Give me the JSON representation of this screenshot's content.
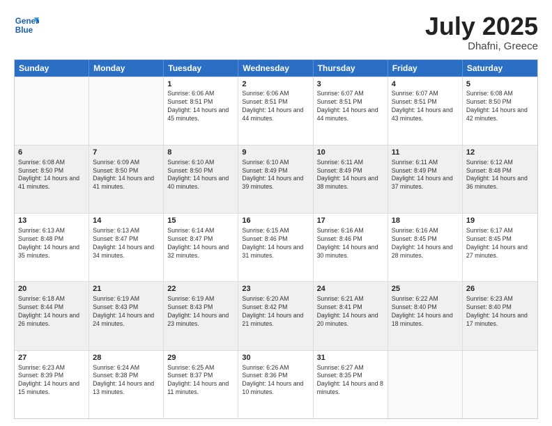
{
  "header": {
    "logo_line1": "General",
    "logo_line2": "Blue",
    "month": "July 2025",
    "location": "Dhafni, Greece"
  },
  "days_of_week": [
    "Sunday",
    "Monday",
    "Tuesday",
    "Wednesday",
    "Thursday",
    "Friday",
    "Saturday"
  ],
  "rows": [
    [
      {
        "day": "",
        "info": "",
        "empty": true
      },
      {
        "day": "",
        "info": "",
        "empty": true
      },
      {
        "day": "1",
        "info": "Sunrise: 6:06 AM\nSunset: 8:51 PM\nDaylight: 14 hours and 45 minutes."
      },
      {
        "day": "2",
        "info": "Sunrise: 6:06 AM\nSunset: 8:51 PM\nDaylight: 14 hours and 44 minutes."
      },
      {
        "day": "3",
        "info": "Sunrise: 6:07 AM\nSunset: 8:51 PM\nDaylight: 14 hours and 44 minutes."
      },
      {
        "day": "4",
        "info": "Sunrise: 6:07 AM\nSunset: 8:51 PM\nDaylight: 14 hours and 43 minutes."
      },
      {
        "day": "5",
        "info": "Sunrise: 6:08 AM\nSunset: 8:50 PM\nDaylight: 14 hours and 42 minutes."
      }
    ],
    [
      {
        "day": "6",
        "info": "Sunrise: 6:08 AM\nSunset: 8:50 PM\nDaylight: 14 hours and 41 minutes.",
        "shaded": true
      },
      {
        "day": "7",
        "info": "Sunrise: 6:09 AM\nSunset: 8:50 PM\nDaylight: 14 hours and 41 minutes.",
        "shaded": true
      },
      {
        "day": "8",
        "info": "Sunrise: 6:10 AM\nSunset: 8:50 PM\nDaylight: 14 hours and 40 minutes.",
        "shaded": true
      },
      {
        "day": "9",
        "info": "Sunrise: 6:10 AM\nSunset: 8:49 PM\nDaylight: 14 hours and 39 minutes.",
        "shaded": true
      },
      {
        "day": "10",
        "info": "Sunrise: 6:11 AM\nSunset: 8:49 PM\nDaylight: 14 hours and 38 minutes.",
        "shaded": true
      },
      {
        "day": "11",
        "info": "Sunrise: 6:11 AM\nSunset: 8:49 PM\nDaylight: 14 hours and 37 minutes.",
        "shaded": true
      },
      {
        "day": "12",
        "info": "Sunrise: 6:12 AM\nSunset: 8:48 PM\nDaylight: 14 hours and 36 minutes.",
        "shaded": true
      }
    ],
    [
      {
        "day": "13",
        "info": "Sunrise: 6:13 AM\nSunset: 8:48 PM\nDaylight: 14 hours and 35 minutes."
      },
      {
        "day": "14",
        "info": "Sunrise: 6:13 AM\nSunset: 8:47 PM\nDaylight: 14 hours and 34 minutes."
      },
      {
        "day": "15",
        "info": "Sunrise: 6:14 AM\nSunset: 8:47 PM\nDaylight: 14 hours and 32 minutes."
      },
      {
        "day": "16",
        "info": "Sunrise: 6:15 AM\nSunset: 8:46 PM\nDaylight: 14 hours and 31 minutes."
      },
      {
        "day": "17",
        "info": "Sunrise: 6:16 AM\nSunset: 8:46 PM\nDaylight: 14 hours and 30 minutes."
      },
      {
        "day": "18",
        "info": "Sunrise: 6:16 AM\nSunset: 8:45 PM\nDaylight: 14 hours and 28 minutes."
      },
      {
        "day": "19",
        "info": "Sunrise: 6:17 AM\nSunset: 8:45 PM\nDaylight: 14 hours and 27 minutes."
      }
    ],
    [
      {
        "day": "20",
        "info": "Sunrise: 6:18 AM\nSunset: 8:44 PM\nDaylight: 14 hours and 26 minutes.",
        "shaded": true
      },
      {
        "day": "21",
        "info": "Sunrise: 6:19 AM\nSunset: 8:43 PM\nDaylight: 14 hours and 24 minutes.",
        "shaded": true
      },
      {
        "day": "22",
        "info": "Sunrise: 6:19 AM\nSunset: 8:43 PM\nDaylight: 14 hours and 23 minutes.",
        "shaded": true
      },
      {
        "day": "23",
        "info": "Sunrise: 6:20 AM\nSunset: 8:42 PM\nDaylight: 14 hours and 21 minutes.",
        "shaded": true
      },
      {
        "day": "24",
        "info": "Sunrise: 6:21 AM\nSunset: 8:41 PM\nDaylight: 14 hours and 20 minutes.",
        "shaded": true
      },
      {
        "day": "25",
        "info": "Sunrise: 6:22 AM\nSunset: 8:40 PM\nDaylight: 14 hours and 18 minutes.",
        "shaded": true
      },
      {
        "day": "26",
        "info": "Sunrise: 6:23 AM\nSunset: 8:40 PM\nDaylight: 14 hours and 17 minutes.",
        "shaded": true
      }
    ],
    [
      {
        "day": "27",
        "info": "Sunrise: 6:23 AM\nSunset: 8:39 PM\nDaylight: 14 hours and 15 minutes."
      },
      {
        "day": "28",
        "info": "Sunrise: 6:24 AM\nSunset: 8:38 PM\nDaylight: 14 hours and 13 minutes."
      },
      {
        "day": "29",
        "info": "Sunrise: 6:25 AM\nSunset: 8:37 PM\nDaylight: 14 hours and 11 minutes."
      },
      {
        "day": "30",
        "info": "Sunrise: 6:26 AM\nSunset: 8:36 PM\nDaylight: 14 hours and 10 minutes."
      },
      {
        "day": "31",
        "info": "Sunrise: 6:27 AM\nSunset: 8:35 PM\nDaylight: 14 hours and 8 minutes."
      },
      {
        "day": "",
        "info": "",
        "empty": true
      },
      {
        "day": "",
        "info": "",
        "empty": true
      }
    ]
  ]
}
